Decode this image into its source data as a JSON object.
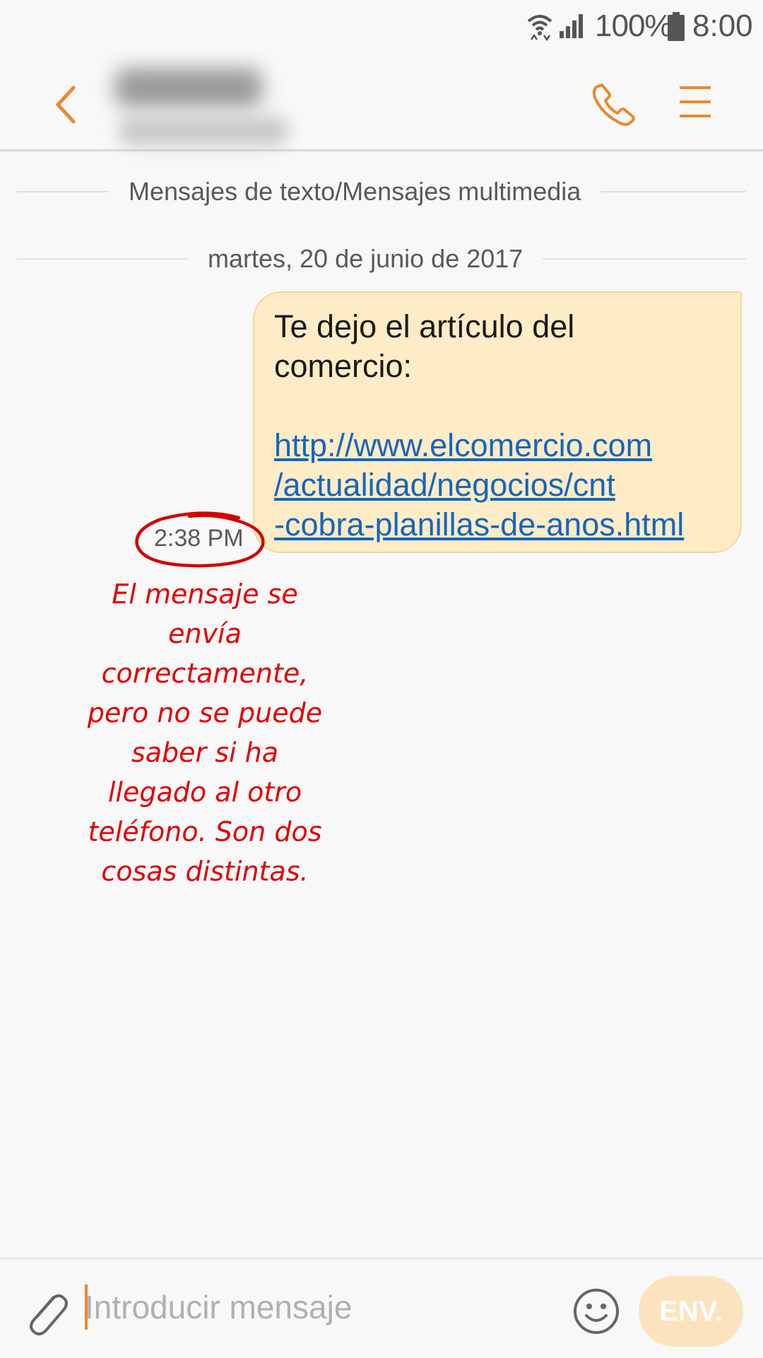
{
  "status_bar": {
    "wifi_icon": "wifi-icon",
    "signal_icon": "signal-icon",
    "battery_percent": "100%",
    "battery_icon": "battery-icon",
    "time": "8:00"
  },
  "header": {
    "back_icon": "chevron-left-icon",
    "contact_name": "",
    "phone_icon": "phone-icon",
    "menu_icon": "menu-icon",
    "accent_color": "#e88a2d"
  },
  "conversation": {
    "message_type_label": "Mensajes de texto/Mensajes multimedia",
    "date_label": "martes, 20 de junio de 2017",
    "messages": [
      {
        "direction": "sent",
        "text": "Te dejo el artículo del\ncomercio:",
        "link": "http://www.elcomercio.com\n/actualidad/negocios/cnt\n-cobra-planillas-de-anos.html",
        "time": "2:38 PM",
        "bubble_color": "#fdecc5"
      }
    ]
  },
  "annotation": {
    "text": "El mensaje se\nenvía\ncorrectamente,\npero no se puede\nsaber si ha\nllegado al otro\nteléfono. Son dos\ncosas distintas.",
    "color": "#e00000"
  },
  "composer": {
    "attach_icon": "paperclip-icon",
    "placeholder": "Introducir mensaje",
    "value": "",
    "emoji_icon": "smiley-icon",
    "send_label": "ENV."
  }
}
